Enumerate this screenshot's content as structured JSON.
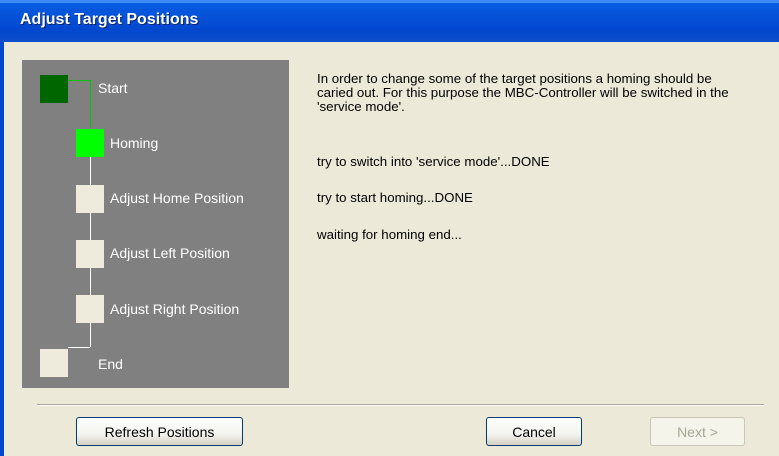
{
  "window": {
    "title": "Adjust Target Positions"
  },
  "steps": [
    {
      "label": "Start",
      "state": "done"
    },
    {
      "label": "Homing",
      "state": "active"
    },
    {
      "label": "Adjust Home Position",
      "state": "pending"
    },
    {
      "label": "Adjust Left Position",
      "state": "pending"
    },
    {
      "label": "Adjust Right Position",
      "state": "pending"
    },
    {
      "label": "End",
      "state": "pending"
    }
  ],
  "content": {
    "intro": "In order to change some of the target positions a homing should be caried out. For this purpose the MBC-Controller will be switched in the 'service mode'.",
    "status": [
      "try to switch into 'service mode'...DONE",
      "try to start homing...DONE",
      "waiting for homing end..."
    ]
  },
  "buttons": {
    "refresh": "Refresh Positions",
    "cancel": "Cancel",
    "next": "Next >"
  },
  "colors": {
    "step_done": "#006600",
    "step_active": "#00FF00",
    "step_pending": "#EEEBDD",
    "panel": "#808080",
    "titlebar": "#0553D9"
  }
}
